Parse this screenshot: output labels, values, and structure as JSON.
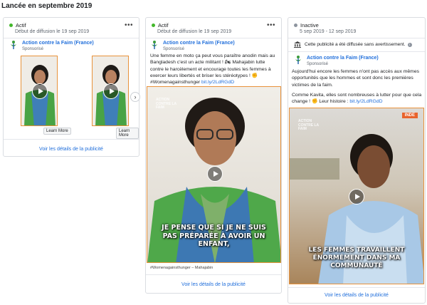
{
  "section_title": "Lancée en septembre 2019",
  "colors": {
    "active": "#42b72a",
    "inactive": "#8d949e",
    "link": "#216fdb",
    "frame": "#e8923b"
  },
  "card1": {
    "status": "Actif",
    "dates": "Début de diffusion le 19 sep 2019",
    "advertiser": "Action contre la Faim (France)",
    "sponsored": "Sponsorisé",
    "learn_more": "Learn More",
    "details": "Voir les détails de la publicité"
  },
  "card2": {
    "status": "Actif",
    "dates": "Début de diffusion le 19 sep 2019",
    "advertiser": "Action contre la Faim (France)",
    "sponsored": "Sponsorisé",
    "body": "Une femme en moto ça peut vous paraître anodin mais au Bangladesh c'est un acte militant ! 🏍 Mahajabin lutte contre le harcèlement et encourage toutes les femmes à exercer leurs libertés et briser les stéréotypes ! ✊ #Womenagainsthunger",
    "link": "bit.ly/2LdRGdD",
    "caption": "JE PENSE QUE SI JE NE SUIS PAS PRÉPARÉE À AVOIR UN ENFANT,",
    "brand": "ACTION CONTRE LA FAIM",
    "subcaption": "#Womenagainsthunger – Mahajabin",
    "details": "Voir les détails de la publicité"
  },
  "card3": {
    "status": "Inactive",
    "dates": "5 sep 2019 - 12 sep 2019",
    "notice": "Cette publicité a été diffusée sans avertissement.",
    "advertiser": "Action contre la Faim (France)",
    "sponsored": "Sponsorisé",
    "body1": "Aujourd'hui encore les femmes n'ont pas accès aux mêmes opportunités que les hommes et sont donc les premières victimes de la faim.",
    "body2": "Comme Kavita, elles sont nombreuses à lutter pour que cela change ! ✊ Leur histoire :",
    "link": "bit.ly/2LdRGdD",
    "badge": "INDE",
    "caption": "LES FEMMES TRAVAILLENT ÉNORMÉMENT DANS MA COMMUNAUTÉ",
    "brand": "ACTION CONTRE LA FAIM",
    "details": "Voir les détails de la publicité"
  }
}
